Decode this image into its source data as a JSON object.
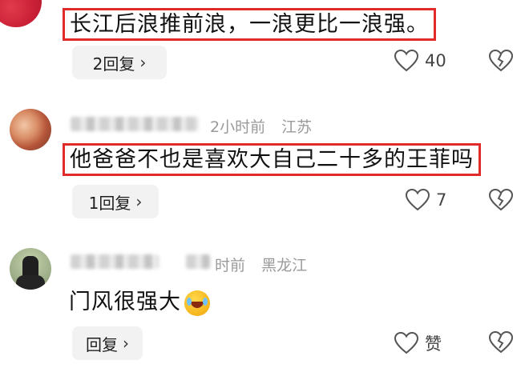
{
  "comments": [
    {
      "text": "长江后浪推前浪，一浪更比一浪强。",
      "reply_label": "2回复",
      "likes": "40"
    },
    {
      "time": "2小时前",
      "location": "江苏",
      "text": "他爸爸不也是喜欢大自己二十多的王菲吗",
      "reply_label": "1回复",
      "likes": "7"
    },
    {
      "time": "时前",
      "location": "黑龙江",
      "text": "门风很强大",
      "reply_label": "回复",
      "likes": "赞"
    }
  ],
  "icons": {
    "chevron": "chevron-right-icon",
    "like": "heart-outline-icon",
    "dislike": "broken-heart-icon",
    "emoji": "laughing-tears-emoji"
  },
  "colors": {
    "highlight_box": "#e12a2a",
    "meta_text": "#9a9a9a",
    "pill_bg": "#f2f2f2"
  }
}
